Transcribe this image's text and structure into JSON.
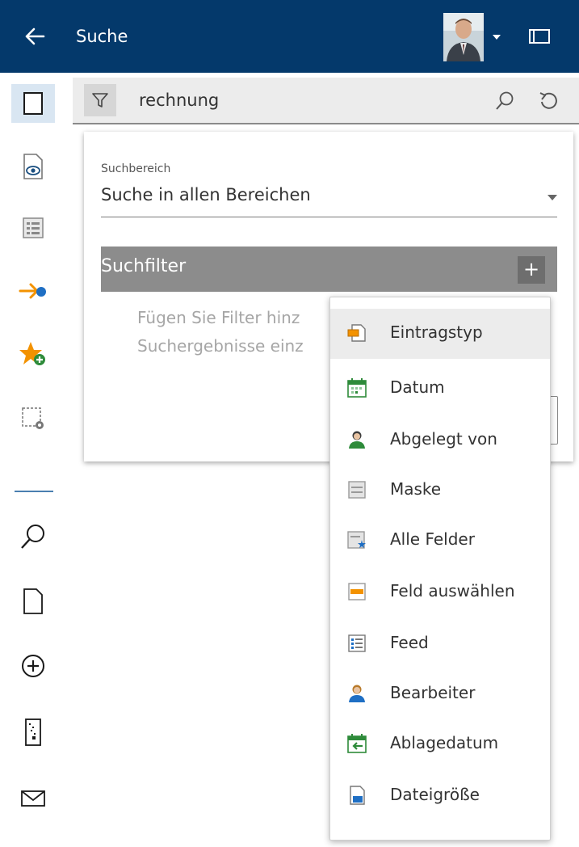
{
  "header": {
    "title": "Suche"
  },
  "search": {
    "query": "rechnung"
  },
  "scope": {
    "label": "Suchbereich",
    "value": "Suche in allen Bereichen"
  },
  "filters": {
    "title": "Suchfilter",
    "add_label": "+",
    "hint_line1": "Fügen Sie Filter hinz",
    "hint_line2": "Suchergebnisse einz"
  },
  "menu": {
    "items": [
      {
        "label": "Eintragstyp",
        "icon": "entry-type-icon"
      },
      {
        "label": "Datum",
        "icon": "calendar-icon"
      },
      {
        "label": "Abgelegt von",
        "icon": "user-green-icon"
      },
      {
        "label": "Maske",
        "icon": "mask-icon"
      },
      {
        "label": "Alle Felder",
        "icon": "all-fields-icon"
      },
      {
        "label": "Feld auswählen",
        "icon": "select-field-icon"
      },
      {
        "label": "Feed",
        "icon": "feed-icon"
      },
      {
        "label": "Bearbeiter",
        "icon": "user-blue-icon"
      },
      {
        "label": "Ablagedatum",
        "icon": "filing-date-icon"
      },
      {
        "label": "Dateigröße",
        "icon": "file-size-icon"
      }
    ]
  },
  "colors": {
    "header_bg": "#04396b",
    "sidebar_active": "#d9e6f2",
    "accent_orange": "#f39200",
    "accent_green": "#2e8b3a",
    "accent_blue": "#1f6fc4"
  }
}
